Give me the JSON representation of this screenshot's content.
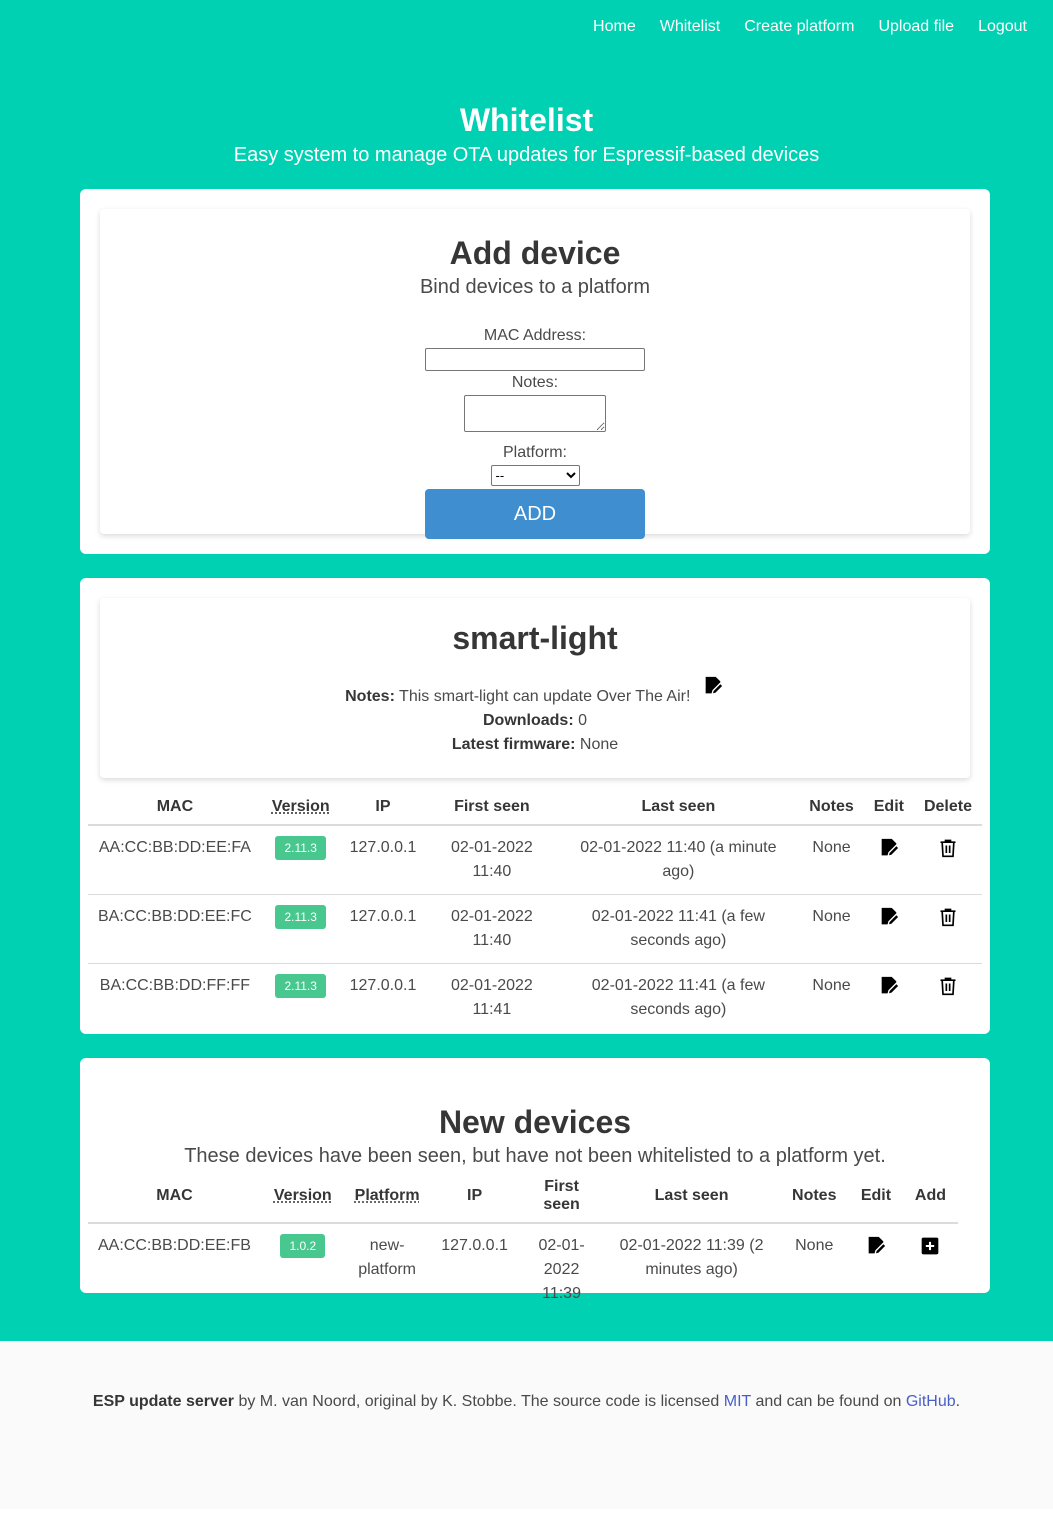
{
  "nav": [
    "Home",
    "Whitelist",
    "Create platform",
    "Upload file",
    "Logout"
  ],
  "hero": {
    "title": "Whitelist",
    "subtitle": "Easy system to manage OTA updates for Espressif-based devices"
  },
  "add_device": {
    "title": "Add device",
    "subtitle": "Bind devices to a platform",
    "mac_label": "MAC Address:",
    "mac_value": "",
    "notes_label": "Notes:",
    "notes_value": "",
    "platform_label": "Platform:",
    "platform_selected": "--",
    "button": "ADD"
  },
  "platform": {
    "name": "smart-light",
    "notes_label": "Notes:",
    "notes": "This smart-light can update Over The Air!",
    "downloads_label": "Downloads:",
    "downloads": "0",
    "latest_label": "Latest firmware:",
    "latest": "None",
    "headers": [
      "MAC",
      "Version",
      "IP",
      "First seen",
      "Last seen",
      "Notes",
      "Edit",
      "Delete"
    ],
    "rows": [
      {
        "mac": "AA:CC:BB:DD:EE:FA",
        "version": "2.11.3",
        "ip": "127.0.0.1",
        "first_seen": "02-01-2022 11:40",
        "last_seen": "02-01-2022 11:40 (a minute ago)",
        "notes": "None"
      },
      {
        "mac": "BA:CC:BB:DD:EE:FC",
        "version": "2.11.3",
        "ip": "127.0.0.1",
        "first_seen": "02-01-2022 11:40",
        "last_seen": "02-01-2022 11:41 (a few seconds ago)",
        "notes": "None"
      },
      {
        "mac": "BA:CC:BB:DD:FF:FF",
        "version": "2.11.3",
        "ip": "127.0.0.1",
        "first_seen": "02-01-2022 11:41",
        "last_seen": "02-01-2022 11:41 (a few seconds ago)",
        "notes": "None"
      }
    ]
  },
  "new_devices": {
    "title": "New devices",
    "subtitle": "These devices have been seen, but have not been whitelisted to a platform yet.",
    "headers": [
      "MAC",
      "Version",
      "Platform",
      "IP",
      "First seen",
      "Last seen",
      "Notes",
      "Edit",
      "Add"
    ],
    "rows": [
      {
        "mac": "AA:CC:BB:DD:EE:FB",
        "version": "1.0.2",
        "platform": "new-platform",
        "ip": "127.0.0.1",
        "first_seen": "02-01-2022 11:39",
        "last_seen": "02-01-2022 11:39 (2 minutes ago)",
        "notes": "None"
      }
    ]
  },
  "footer": {
    "app_name": "ESP update server",
    "text_1": " by M. van Noord, original by K. Stobbe. The source code is licensed ",
    "license": "MIT",
    "text_2": " and can be found on ",
    "github": "GitHub",
    "text_3": "."
  },
  "colors": {
    "hero": "#00d1b2",
    "button": "#3e8ed0",
    "tag": "#48c78e",
    "link": "#485fc7"
  }
}
